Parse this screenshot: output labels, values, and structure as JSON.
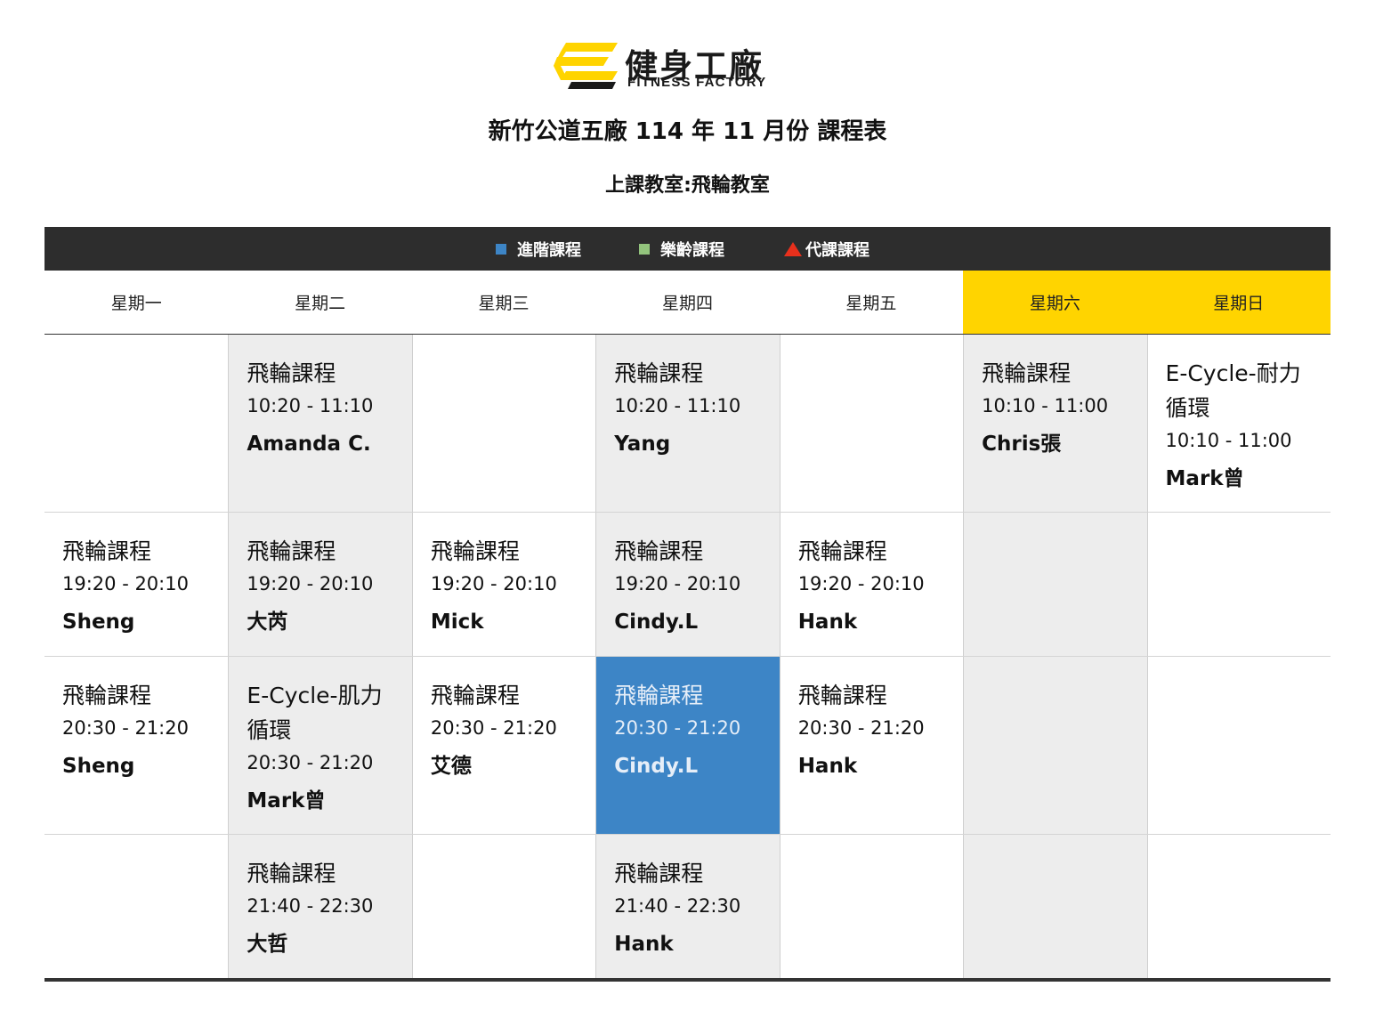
{
  "brand": {
    "name_cn": "健身工廠",
    "name_en": "FITNESS FACTORY",
    "logo_icon": "fitness-factory-logo-icon",
    "accent": "#ffd400"
  },
  "header": {
    "title": "新竹公道五廠 114 年 11 月份 課程表",
    "room": "上課教室:飛輪教室"
  },
  "legend": [
    {
      "label": "進階課程",
      "marker": "blue-square",
      "color": "#3d85c6"
    },
    {
      "label": "樂齡課程",
      "marker": "green-square",
      "color": "#93c47d"
    },
    {
      "label": "代課課程",
      "marker": "red-triangle",
      "color": "#e8301c"
    }
  ],
  "days": [
    "星期一",
    "星期二",
    "星期三",
    "星期四",
    "星期五",
    "星期六",
    "星期日"
  ],
  "schedule": [
    [
      null,
      {
        "name": "飛輪課程",
        "time": "10:20 - 11:10",
        "teacher": "Amanda C."
      },
      null,
      {
        "name": "飛輪課程",
        "time": "10:20 - 11:10",
        "teacher": "Yang"
      },
      null,
      {
        "name": "飛輪課程",
        "time": "10:10 - 11:00",
        "teacher": "Chris張"
      },
      {
        "name": "E-Cycle-耐力循環",
        "time": "10:10 - 11:00",
        "teacher": "Mark曾"
      }
    ],
    [
      {
        "name": "飛輪課程",
        "time": "19:20 - 20:10",
        "teacher": "Sheng"
      },
      {
        "name": "飛輪課程",
        "time": "19:20 - 20:10",
        "teacher": "大芮"
      },
      {
        "name": "飛輪課程",
        "time": "19:20 - 20:10",
        "teacher": "Mick"
      },
      {
        "name": "飛輪課程",
        "time": "19:20 - 20:10",
        "teacher": "Cindy.L"
      },
      {
        "name": "飛輪課程",
        "time": "19:20 - 20:10",
        "teacher": "Hank"
      },
      null,
      null
    ],
    [
      {
        "name": "飛輪課程",
        "time": "20:30 - 21:20",
        "teacher": "Sheng"
      },
      {
        "name": "E-Cycle-肌力循環",
        "time": "20:30 - 21:20",
        "teacher": "Mark曾"
      },
      {
        "name": "飛輪課程",
        "time": "20:30 - 21:20",
        "teacher": "艾德"
      },
      {
        "name": "飛輪課程",
        "time": "20:30 - 21:20",
        "teacher": "Cindy.L",
        "type": "進階課程"
      },
      {
        "name": "飛輪課程",
        "time": "20:30 - 21:20",
        "teacher": "Hank"
      },
      null,
      null
    ],
    [
      null,
      {
        "name": "飛輪課程",
        "time": "21:40 - 22:30",
        "teacher": "大哲"
      },
      null,
      {
        "name": "飛輪課程",
        "time": "21:40 - 22:30",
        "teacher": "Hank"
      },
      null,
      null,
      null
    ]
  ]
}
